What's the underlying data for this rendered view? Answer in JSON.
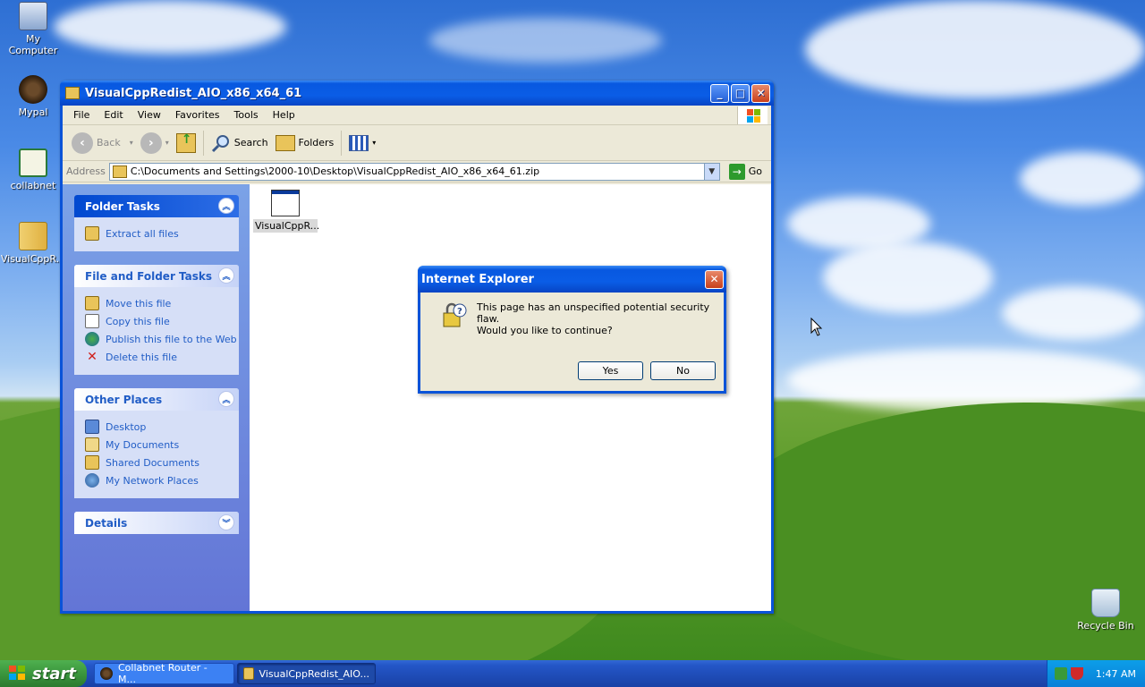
{
  "desktop": {
    "icons": [
      {
        "label": "My Computer"
      },
      {
        "label": "Mypal"
      },
      {
        "label": "collabnet"
      },
      {
        "label": "VisualCppR..."
      },
      {
        "label": "Recycle Bin"
      }
    ]
  },
  "window": {
    "title": "VisualCppRedist_AIO_x86_x64_61",
    "menu": [
      "File",
      "Edit",
      "View",
      "Favorites",
      "Tools",
      "Help"
    ],
    "toolbar": {
      "back": "Back",
      "search": "Search",
      "folders": "Folders"
    },
    "address": {
      "label": "Address",
      "value": "C:\\Documents and Settings\\2000-10\\Desktop\\VisualCppRedist_AIO_x86_x64_61.zip",
      "go": "Go"
    },
    "taskpane": {
      "folder_tasks": {
        "title": "Folder Tasks",
        "items": [
          "Extract all files"
        ]
      },
      "file_folder_tasks": {
        "title": "File and Folder Tasks",
        "items": [
          "Move this file",
          "Copy this file",
          "Publish this file to the Web",
          "Delete this file"
        ]
      },
      "other_places": {
        "title": "Other Places",
        "items": [
          "Desktop",
          "My Documents",
          "Shared Documents",
          "My Network Places"
        ]
      },
      "details": {
        "title": "Details"
      }
    },
    "files": [
      {
        "name": "VisualCppR..."
      }
    ]
  },
  "dialog": {
    "title": "Internet Explorer",
    "message_line1": "This page has an unspecified potential security flaw.",
    "message_line2": "Would you like to continue?",
    "yes": "Yes",
    "no": "No"
  },
  "taskbar": {
    "start": "start",
    "tasks": [
      {
        "label": "Collabnet Router - M..."
      },
      {
        "label": "VisualCppRedist_AIO..."
      }
    ],
    "clock": "1:47 AM"
  },
  "colors": {
    "xp_blue": "#0a53d8",
    "task_link": "#215dc6",
    "start_green": "#37913a"
  }
}
